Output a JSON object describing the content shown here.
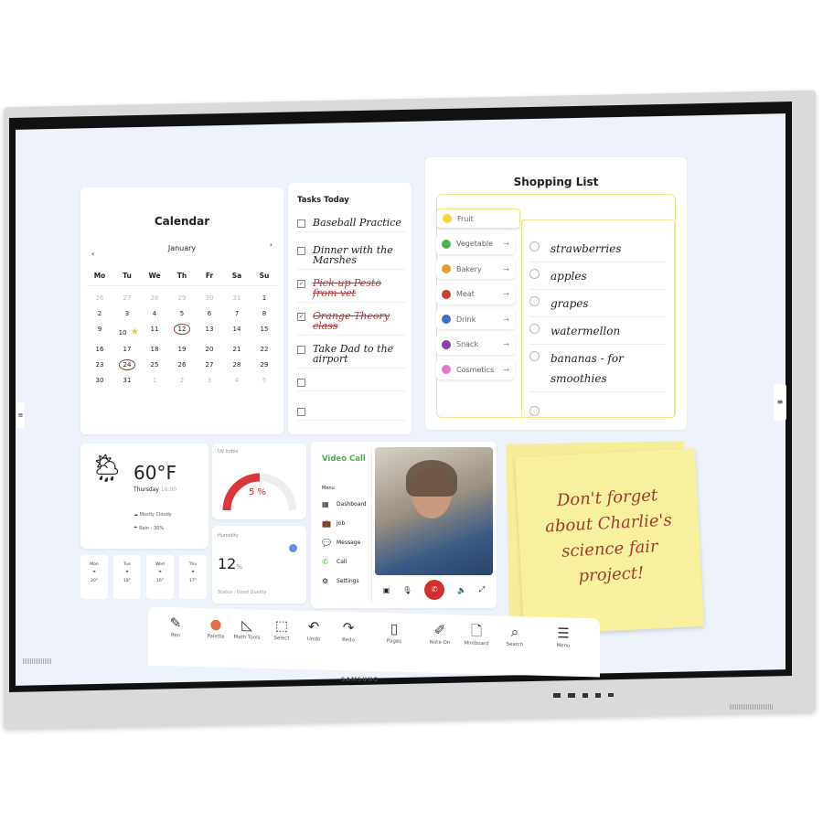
{
  "device": {
    "brand": "SAMSUNG"
  },
  "calendar": {
    "title": "Calendar",
    "month": "January",
    "prev_icon": "chevron-left",
    "next_icon": "chevron-right",
    "weekdays": [
      "Mo",
      "Tu",
      "We",
      "Th",
      "Fr",
      "Sa",
      "Su"
    ],
    "days": [
      "26",
      "27",
      "28",
      "29",
      "30",
      "31",
      "1",
      "2",
      "3",
      "4",
      "5",
      "6",
      "7",
      "8",
      "9",
      "10",
      "11",
      "12",
      "13",
      "14",
      "15",
      "16",
      "17",
      "18",
      "19",
      "20",
      "21",
      "22",
      "23",
      "24",
      "25",
      "26",
      "27",
      "28",
      "29",
      "30",
      "31",
      "1",
      "2",
      "3",
      "4",
      "5"
    ],
    "circled": [
      "12",
      "24"
    ],
    "starred": "10"
  },
  "tasks": {
    "title": "Tasks Today",
    "items": [
      {
        "text": "Baseball Practice",
        "done": false
      },
      {
        "text": "Dinner with the Marshes",
        "done": false
      },
      {
        "text": "Pick up Pesto from vet",
        "done": true
      },
      {
        "text": "Orange Theory class",
        "done": true
      },
      {
        "text": "Take Dad to the airport",
        "done": false
      },
      {
        "text": "",
        "done": false
      },
      {
        "text": "",
        "done": false
      }
    ]
  },
  "shopping": {
    "title": "Shopping List",
    "categories": [
      {
        "label": "Fruit",
        "color": "#f2d53c"
      },
      {
        "label": "Vegetable",
        "color": "#4caf50"
      },
      {
        "label": "Bakery",
        "color": "#e0a030"
      },
      {
        "label": "Meat",
        "color": "#c8402e"
      },
      {
        "label": "Drink",
        "color": "#3f6fc0"
      },
      {
        "label": "Snack",
        "color": "#8a3fa8"
      },
      {
        "label": "Cosmetics",
        "color": "#e07ac8"
      }
    ],
    "items": [
      "strawberries",
      "apples",
      "grapes",
      "watermellon",
      "bananas - for smoothies",
      ""
    ]
  },
  "weather": {
    "temp": "60°F",
    "day": "Thursday",
    "time": "16:00",
    "condition": "Mostly Cloudy",
    "rain": "Rain - 30%",
    "forecast": [
      {
        "day": "Mon",
        "temp": "20°"
      },
      {
        "day": "Tue",
        "temp": "18°"
      },
      {
        "day": "Wed",
        "temp": "16°"
      },
      {
        "day": "Thu",
        "temp": "17°"
      }
    ]
  },
  "uv": {
    "label": "UV Index",
    "value": "5 %",
    "level": 0.5,
    "accent": "#d9363e"
  },
  "humidity": {
    "label": "Humidity",
    "value": "12",
    "unit": "%",
    "status": "Status : Good Quality"
  },
  "video_call": {
    "title": "Video Call",
    "menu_label": "Menu",
    "accent": "#4caf50",
    "menu": [
      {
        "label": "Dashboard",
        "icon": "grid"
      },
      {
        "label": "Job",
        "icon": "briefcase"
      },
      {
        "label": "Message",
        "icon": "chat"
      },
      {
        "label": "Call",
        "icon": "phone"
      },
      {
        "label": "Settings",
        "icon": "gear"
      }
    ],
    "controls": [
      "camera-off",
      "mic-off",
      "end-call",
      "speaker",
      "expand"
    ]
  },
  "sticky_note": {
    "text": "Don't forget about Charlie's science fair project!",
    "color": "#f8f1a0"
  },
  "toolbar": [
    {
      "label": "Pen",
      "icon": "✎"
    },
    {
      "label": "Palette",
      "icon": "●"
    },
    {
      "label": "Math Tools",
      "icon": "◺"
    },
    {
      "label": "Select",
      "icon": "⬚"
    },
    {
      "label": "Undo",
      "icon": "↶"
    },
    {
      "label": "Redo",
      "icon": "↷"
    },
    {
      "label": "Pages",
      "icon": "▯"
    },
    {
      "label": "Note On",
      "icon": "✐"
    },
    {
      "label": "Miniboard",
      "icon": "🗋"
    },
    {
      "label": "Search",
      "icon": "⌕"
    },
    {
      "label": "Menu",
      "icon": "☰"
    }
  ]
}
